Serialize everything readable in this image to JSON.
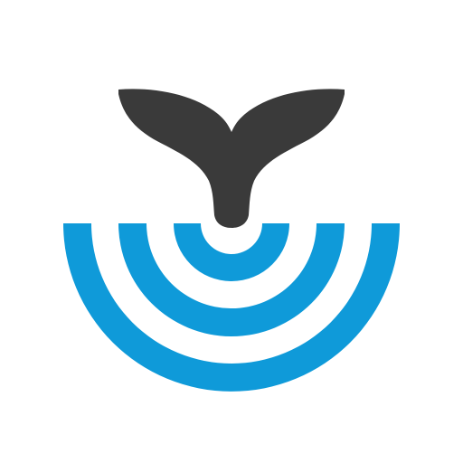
{
  "logo": {
    "icon": "whale-tail-ripples-icon",
    "colors": {
      "tail": "#3a3a3a",
      "ripples": "#0f9ad9",
      "background": "#ffffff"
    }
  }
}
